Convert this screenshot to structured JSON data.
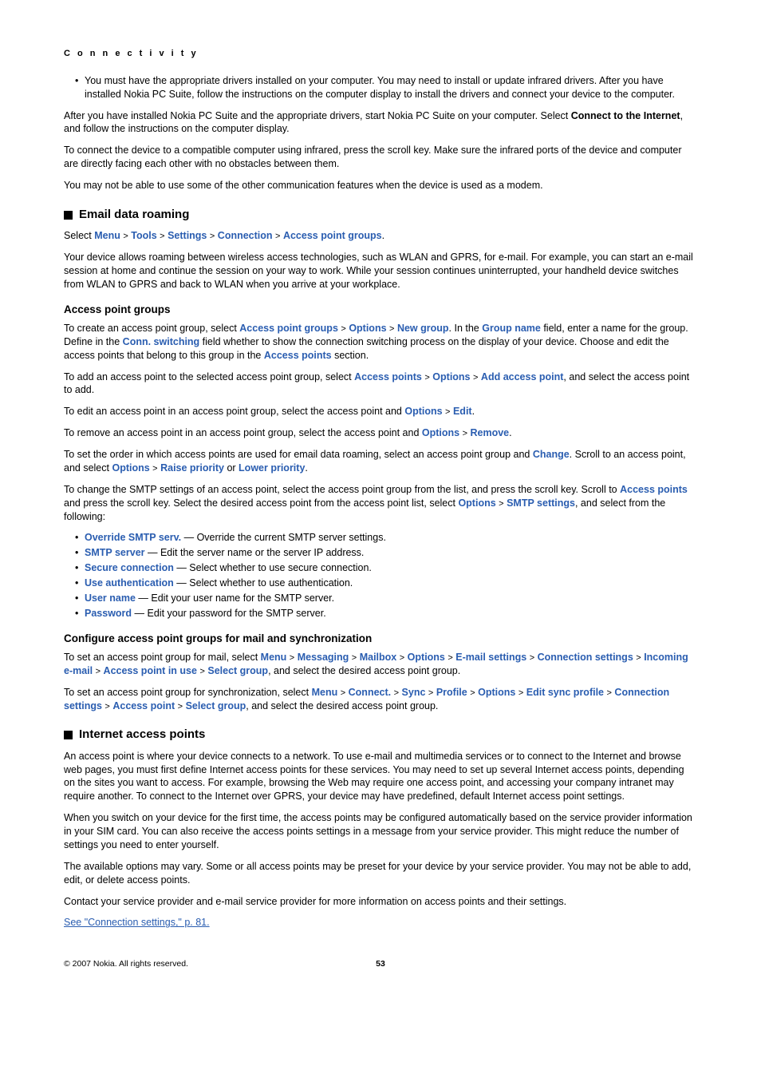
{
  "header": {
    "section": "C o n n e c t i v i t y"
  },
  "intro_bullet": "You must have the appropriate drivers installed on your computer. You may need to install or update infrared drivers. After you have installed Nokia PC Suite, follow the instructions on the computer display to install the drivers and connect your device to the computer.",
  "p1a": "After you have installed Nokia PC Suite and the appropriate drivers, start Nokia PC Suite on your computer. Select ",
  "p1b": "Connect to the Internet",
  "p1c": ", and follow the instructions on the computer display.",
  "p2": "To connect the device to a compatible computer using infrared, press the scroll key. Make sure the infrared ports of the device and computer are directly facing each other with no obstacles between them.",
  "p3": "You may not be able to use some of the other communication features when the device is used as a modem.",
  "h_email": "Email data roaming",
  "sel_prefix": "Select ",
  "nav": {
    "menu": "Menu",
    "tools": "Tools",
    "settings": "Settings",
    "connection": "Connection",
    "apg": "Access point groups"
  },
  "chev": ">",
  "p4": "Your device allows roaming between wireless access technologies, such as WLAN and GPRS, for e-mail. For example, you can start an e-mail session at home and continue the session on your way to work. While your session continues uninterrupted, your handheld device switches from WLAN to GPRS and back to WLAN when you arrive at your workplace.",
  "h_apg": "Access point groups",
  "p5a": "To create an access point group, select ",
  "p5b": "Access point groups",
  "p5c": "Options",
  "p5d": "New group",
  "p5e": ". In the ",
  "p5f": "Group name",
  "p5g": " field, enter a name for the group. Define in the ",
  "p5h": "Conn. switching",
  "p5i": " field whether to show the connection switching process on the display of your device. Choose and edit the access points that belong to this group in the ",
  "p5j": "Access points",
  "p5k": " section.",
  "p6a": "To add an access point to the selected access point group, select ",
  "p6b": "Access points",
  "p6c": "Options",
  "p6d": "Add access point",
  "p6e": ", and select the access point to add.",
  "p7a": "To edit an access point in an access point group, select the access point and ",
  "p7b": "Options",
  "p7c": "Edit",
  "p8a": "To remove an access point in an access point group, select the access point and ",
  "p8b": "Options",
  "p8c": "Remove",
  "p9a": "To set the order in which access points are used for email data roaming, select an access point group and ",
  "p9b": "Change",
  "p9c": ". Scroll to an access point, and select ",
  "p9d": "Options",
  "p9e": "Raise priority",
  "p9f": " or ",
  "p9g": "Lower priority",
  "p10a": "To change the SMTP settings of an access point, select the access point group from the list, and press the scroll key. Scroll to ",
  "p10b": "Access points",
  "p10c": " and press the scroll key. Select the desired access point from the access point list, select ",
  "p10d": "Options",
  "p10e": "SMTP settings",
  "p10f": ", and select from the following:",
  "smtp": [
    {
      "label": "Override SMTP serv.",
      "desc": " — Override the current SMTP server settings."
    },
    {
      "label": "SMTP server",
      "desc": " — Edit the server name or the server IP address."
    },
    {
      "label": "Secure connection",
      "desc": " — Select whether to use secure connection."
    },
    {
      "label": "Use authentication",
      "desc": " — Select whether to use authentication."
    },
    {
      "label": "User name",
      "desc": " — Edit your user name for the SMTP server."
    },
    {
      "label": "Password",
      "desc": " — Edit your password for the SMTP server."
    }
  ],
  "h_conf": "Configure access point groups for mail and synchronization",
  "p11a": "To set an access point group for mail, select ",
  "p11": {
    "menu": "Menu",
    "msg": "Messaging",
    "mbox": "Mailbox",
    "opt": "Options",
    "ems": "E-mail settings",
    "cs": "Connection settings",
    "ie": "Incoming e-mail",
    "apiu": "Access point in use",
    "sg": "Select group"
  },
  "p11z": ", and select the desired access point group.",
  "p12a": "To set an access point group for synchronization, select ",
  "p12": {
    "menu": "Menu",
    "conn": "Connect.",
    "sync": "Sync",
    "prof": "Profile",
    "opt": "Options",
    "esp": "Edit sync profile",
    "cs": "Connection settings",
    "ap": "Access point",
    "sg": "Select group"
  },
  "p12z": ", and select the desired access point group.",
  "h_iap": "Internet access points",
  "p13": "An access point is where your device connects to a network. To use e-mail and multimedia services or to connect to the Internet and browse web pages, you must first define Internet access points for these services. You may need to set up several Internet access points, depending on the sites you want to access. For example, browsing the Web may require one access point, and accessing your company intranet may require another. To connect to the Internet over GPRS, your device may have predefined, default Internet access point settings.",
  "p14": "When you switch on your device for the first time, the access points may be configured automatically based on the service provider information in your SIM card. You can also receive the access points settings in a message from your service provider. This might reduce the number of settings you need to enter yourself.",
  "p15": "The available options may vary. Some or all access points may be preset for your device by your service provider. You may not be able to add, edit, or delete access points.",
  "p16": "Contact your service provider and e-mail service provider for more information on access points and their settings.",
  "see": "See \"Connection settings,\" p. 81.",
  "footer": {
    "copy": "© 2007 Nokia. All rights reserved.",
    "page": "53"
  }
}
